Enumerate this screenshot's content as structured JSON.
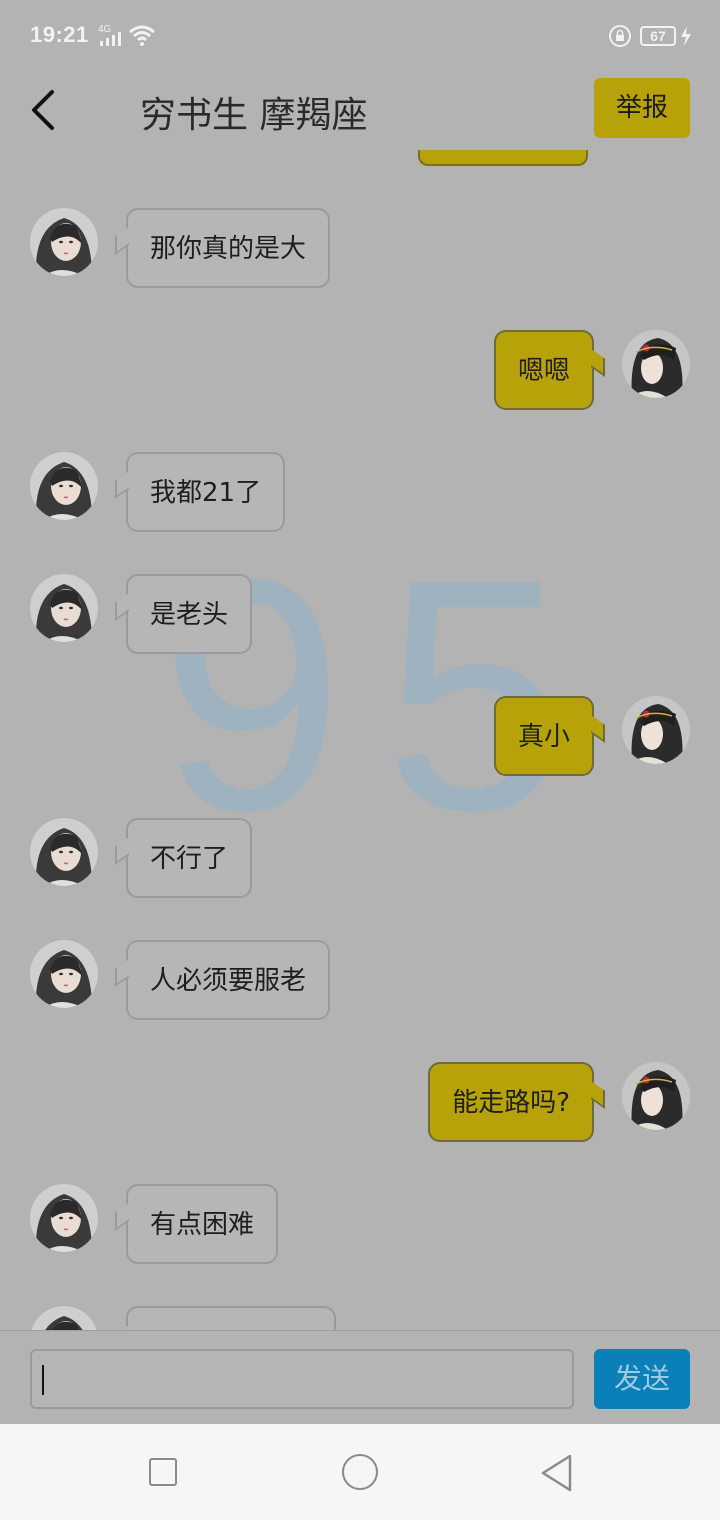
{
  "status_bar": {
    "time": "19:21",
    "network": "4G",
    "battery": "67"
  },
  "header": {
    "back_icon": "chevron-left-icon",
    "title": "穷书生 摩羯座",
    "report_label": "举报"
  },
  "watermark": "95",
  "colors": {
    "background": "#b3b3b3",
    "self_bubble": "#b8a20a",
    "other_bubble": "#b6b6b6",
    "send_button": "#0a7fb8"
  },
  "messages": [
    {
      "side": "left",
      "text": "那你真的是大"
    },
    {
      "side": "right",
      "text": "嗯嗯"
    },
    {
      "side": "left",
      "text": "我都21了"
    },
    {
      "side": "left",
      "text": "是老头"
    },
    {
      "side": "right",
      "text": "真小"
    },
    {
      "side": "left",
      "text": "不行了"
    },
    {
      "side": "left",
      "text": "人必须要服老"
    },
    {
      "side": "right",
      "text": "能走路吗?"
    },
    {
      "side": "left",
      "text": "有点困难"
    },
    {
      "side": "left",
      "text": ""
    }
  ],
  "composer": {
    "value": "",
    "send_label": "发送"
  },
  "nav_bar": {
    "recents_icon": "square-icon",
    "home_icon": "circle-icon",
    "back_icon": "triangle-back-icon"
  }
}
